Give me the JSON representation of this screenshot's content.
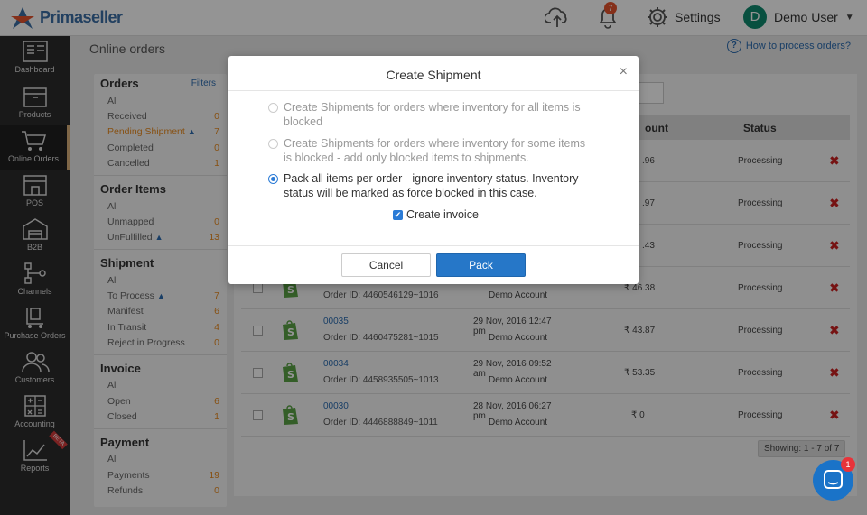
{
  "app": {
    "name": "Primaseller"
  },
  "topbar": {
    "notification_count": "7",
    "settings_label": "Settings",
    "user_initial": "D",
    "user_name": "Demo User"
  },
  "sidebar": {
    "items": [
      {
        "label": "Dashboard"
      },
      {
        "label": "Products"
      },
      {
        "label": "Online Orders"
      },
      {
        "label": "POS"
      },
      {
        "label": "B2B"
      },
      {
        "label": "Channels"
      },
      {
        "label": "Purchase Orders"
      },
      {
        "label": "Customers"
      },
      {
        "label": "Accounting"
      },
      {
        "label": "Reports",
        "badge": "BETA"
      }
    ]
  },
  "page": {
    "title": "Online orders",
    "help_link": "How to process orders?"
  },
  "filters": {
    "filters_link": "Filters",
    "orders": {
      "title": "Orders",
      "rows": [
        {
          "label": "All",
          "count": ""
        },
        {
          "label": "Received",
          "count": "0"
        },
        {
          "label": "Pending Shipment",
          "count": "7"
        },
        {
          "label": "Completed",
          "count": "0"
        },
        {
          "label": "Cancelled",
          "count": "1"
        }
      ]
    },
    "order_items": {
      "title": "Order Items",
      "rows": [
        {
          "label": "All",
          "count": ""
        },
        {
          "label": "Unmapped",
          "count": "0"
        },
        {
          "label": "UnFulfilled",
          "count": "13"
        }
      ]
    },
    "shipment": {
      "title": "Shipment",
      "rows": [
        {
          "label": "All",
          "count": ""
        },
        {
          "label": "To Process",
          "count": "7"
        },
        {
          "label": "Manifest",
          "count": "6"
        },
        {
          "label": "In Transit",
          "count": "4"
        },
        {
          "label": "Reject in Progress",
          "count": "0"
        }
      ]
    },
    "invoice": {
      "title": "Invoice",
      "rows": [
        {
          "label": "All",
          "count": ""
        },
        {
          "label": "Open",
          "count": "6"
        },
        {
          "label": "Closed",
          "count": "1"
        }
      ]
    },
    "payment": {
      "title": "Payment",
      "rows": [
        {
          "label": "All",
          "count": ""
        },
        {
          "label": "Payments",
          "count": "19"
        },
        {
          "label": "Refunds",
          "count": "0"
        }
      ]
    }
  },
  "table": {
    "headers": {
      "amount": "ount",
      "status": "Status"
    },
    "partial_rows": [
      {
        "amount": ".96",
        "status": "Processing"
      },
      {
        "amount": ".97",
        "status": "Processing"
      },
      {
        "amount": ".43",
        "status": "Processing"
      }
    ],
    "rows": [
      {
        "order_num": "",
        "order_id": "Order ID: 4460546129~1016",
        "date": "",
        "account": "Demo Account",
        "amount": "₹ 46.38",
        "status": "Processing"
      },
      {
        "order_num": "00035",
        "order_id": "Order ID: 4460475281~1015",
        "date": "29 Nov, 2016 12:47 pm",
        "account": "Demo Account",
        "amount": "₹ 43.87",
        "status": "Processing"
      },
      {
        "order_num": "00034",
        "order_id": "Order ID: 4458935505~1013",
        "date": "29 Nov, 2016 09:52 am",
        "account": "Demo Account",
        "amount": "₹ 53.35",
        "status": "Processing"
      },
      {
        "order_num": "00030",
        "order_id": "Order ID: 4446888849~1011",
        "date": "28 Nov, 2016 06:27 pm",
        "account": "Demo Account",
        "amount": "₹ 0",
        "status": "Processing"
      }
    ],
    "showing": "Showing: 1 - 7 of 7"
  },
  "modal": {
    "title": "Create Shipment",
    "options": [
      {
        "text": "Create Shipments for orders where inventory for all items is blocked",
        "selected": false
      },
      {
        "text": "Create Shipments for orders where inventory for some items is blocked - add only blocked items to shipments.",
        "selected": false
      },
      {
        "text": "Pack all items per order - ignore inventory status. Inventory status will be marked as force blocked in this case.",
        "selected": true
      }
    ],
    "create_invoice_label": "Create invoice",
    "create_invoice_checked": true,
    "cancel_label": "Cancel",
    "pack_label": "Pack"
  },
  "chat": {
    "badge": "1"
  }
}
